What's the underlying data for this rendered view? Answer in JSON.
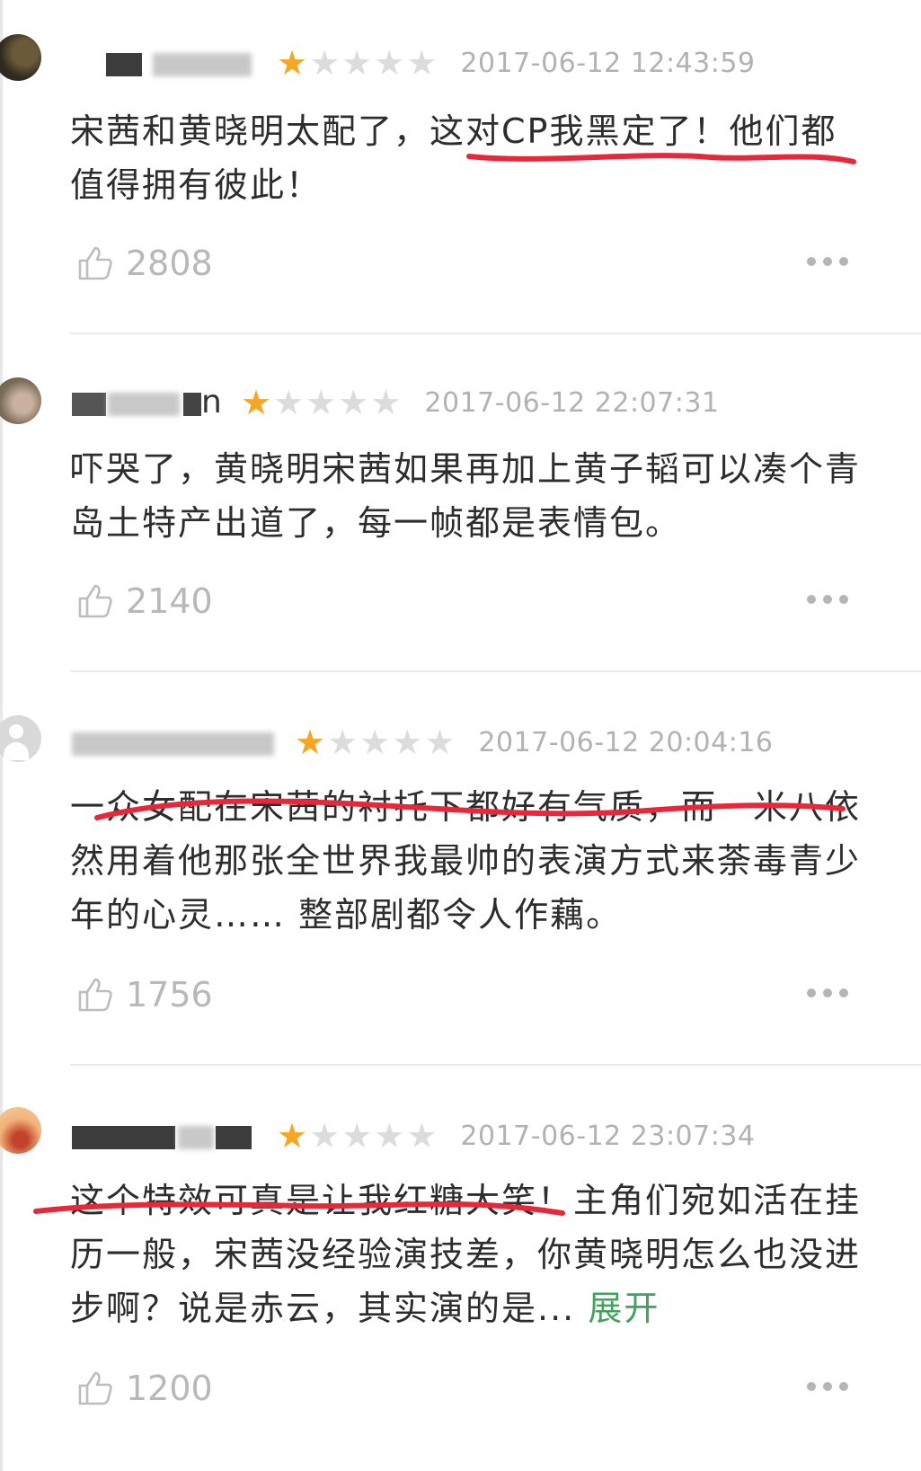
{
  "reviews": [
    {
      "username_visible": "",
      "rating": 1,
      "max_rating": 5,
      "timestamp": "2017-06-12 12:43:59",
      "comment": "宋茜和黄晓明太配了，这对CP我黑定了！他们都值得拥有彼此！",
      "likes": "2808"
    },
    {
      "username_visible": "n",
      "rating": 1,
      "max_rating": 5,
      "timestamp": "2017-06-12 22:07:31",
      "comment": "吓哭了，黄晓明宋茜如果再加上黄子韬可以凑个青岛土特产出道了，每一帧都是表情包。",
      "likes": "2140"
    },
    {
      "username_visible": "",
      "rating": 1,
      "max_rating": 5,
      "timestamp": "2017-06-12 20:04:16",
      "comment": "一众女配在宋茜的衬托下都好有气质，而一米八依然用着他那张全世界我最帅的表演方式来荼毒青少年的心灵…… 整部剧都令人作藕。",
      "likes": "1756"
    },
    {
      "username_visible": "",
      "rating": 1,
      "max_rating": 5,
      "timestamp": "2017-06-12 23:07:34",
      "comment": "这个特效可真是让我红糖大笑！主角们宛如活在挂历一般，宋茜没经验演技差，你黄晓明怎么也没进步啊？说是赤云，其实演的是...",
      "expand_label": "展开",
      "likes": "1200"
    }
  ],
  "icons": {
    "like": "thumbs-up-outline-icon",
    "more": "more-dots-icon",
    "star": "star-icon"
  },
  "colors": {
    "star_on": "#f5a623",
    "star_off": "#dcdcdc",
    "expand_link": "#3fa35d",
    "annotation_red": "#e8283a"
  }
}
